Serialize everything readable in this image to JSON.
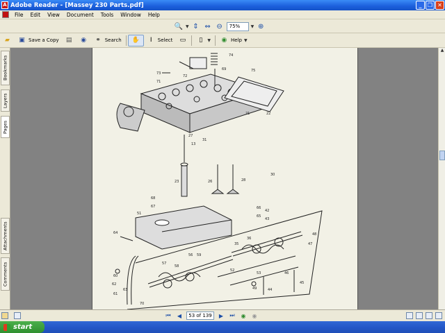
{
  "window": {
    "title": "Adobe Reader - [Massey 230 Parts.pdf]",
    "app_icon": "adobe-reader-icon",
    "controls": [
      "minimize",
      "restore",
      "close"
    ]
  },
  "menu": {
    "items": [
      "File",
      "Edit",
      "View",
      "Document",
      "Tools",
      "Window",
      "Help"
    ]
  },
  "zoom_toolbar": {
    "zoom_value": "75%"
  },
  "main_toolbar": {
    "save_copy_label": "Save a Copy",
    "search_label": "Search",
    "select_label": "Select",
    "help_label": "Help"
  },
  "nav_tabs": [
    "Bookmarks",
    "Layers",
    "Pages",
    "Attachments",
    "Comments"
  ],
  "page_nav": {
    "page_display": "53 of 139"
  },
  "taskbar": {
    "start_label": "start"
  },
  "diagram": {
    "callouts": [
      "73",
      "71",
      "72",
      "74",
      "69",
      "75",
      "51",
      "66",
      "65",
      "64",
      "56",
      "60",
      "62",
      "61",
      "57",
      "58",
      "59",
      "63",
      "67",
      "68",
      "70",
      "27",
      "13",
      "23",
      "26",
      "28",
      "30",
      "31",
      "21",
      "22",
      "35",
      "36",
      "42",
      "43",
      "44",
      "45",
      "46",
      "48",
      "47",
      "49",
      "53",
      "52"
    ]
  }
}
